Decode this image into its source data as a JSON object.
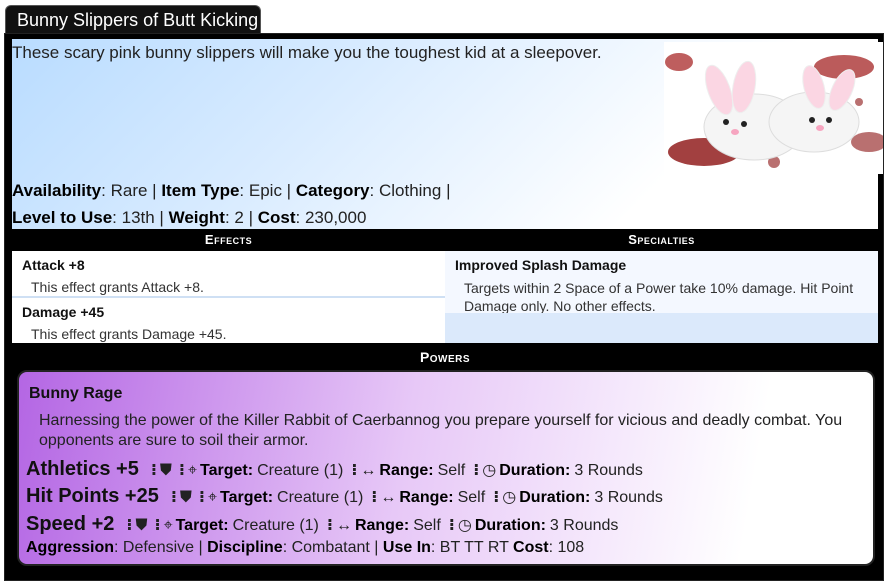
{
  "item": {
    "title": "Bunny Slippers of Butt Kicking",
    "description": "These scary pink bunny slippers will make you the toughest kid at a sleepover.",
    "availability_label": "Availability",
    "availability": "Rare",
    "item_type_label": "Item Type",
    "item_type": "Epic",
    "category_label": "Category",
    "category": "Clothing",
    "level_label": "Level to Use",
    "level": "13th",
    "weight_label": "Weight",
    "weight": "2",
    "cost_label": "Cost",
    "cost": "230,000"
  },
  "effects": {
    "header": "Effects",
    "items": [
      {
        "title": "Attack +8",
        "desc": "This effect grants Attack +8."
      },
      {
        "title": "Damage +45",
        "desc": "This effect grants Damage +45."
      }
    ]
  },
  "specialties": {
    "header": "Specialties",
    "items": [
      {
        "title": "Improved Splash Damage",
        "desc": "Targets within 2 Space of a Power take 10% damage. Hit Point Damage only. No other effects."
      }
    ]
  },
  "powers": {
    "header": "Powers",
    "name": "Bunny Rage",
    "description": "Harnessing the power of the Killer Rabbit of Caerbannog you prepare yourself for vicious and deadly combat. You opponents are sure to soil their armor.",
    "labels": {
      "target": "Target:",
      "range": "Range:",
      "duration": "Duration:"
    },
    "stats": [
      {
        "name": "Athletics +5",
        "target": "Creature (1)",
        "range": "Self",
        "duration": "3 Rounds"
      },
      {
        "name": "Hit Points +25",
        "target": "Creature (1)",
        "range": "Self",
        "duration": "3 Rounds"
      },
      {
        "name": "Speed +2",
        "target": "Creature (1)",
        "range": "Self",
        "duration": "3 Rounds"
      }
    ],
    "aggression_label": "Aggression",
    "aggression": "Defensive",
    "discipline_label": "Discipline",
    "discipline": "Combatant",
    "use_in_label": "Use In",
    "use_in": "BT TT RT",
    "cost_label": "Cost",
    "cost": "108"
  },
  "icons": [
    "shield-icon",
    "crosshair-icon",
    "arrows-icon",
    "clock-icon",
    "vertical-dots-icon"
  ],
  "colors": {
    "effects_bg": "#ffffff",
    "power_gradient_start": "#b466e4",
    "header_bg": "#000000"
  }
}
